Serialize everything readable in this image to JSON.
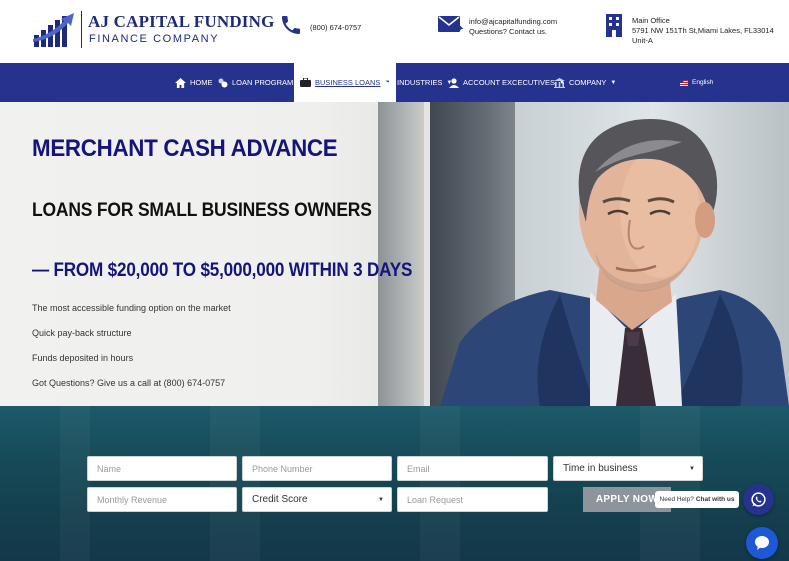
{
  "brand": {
    "title": "AJ CAPITAL FUNDING",
    "subtitle": "FINANCE COMPANY",
    "color": "#1e2a78"
  },
  "contacts": {
    "phone": "(800) 674-0757",
    "email_line1": "info@ajcapitalfunding.com",
    "email_line2": "Questions? Contact us.",
    "office_line1": "Main Office",
    "office_line2": "5791 NW 151Th St,Miami Lakes, FL33014",
    "office_line3": "Unit-A"
  },
  "nav": {
    "items": [
      {
        "label": "HOME",
        "icon": "home-icon"
      },
      {
        "label": "LOAN PROGRAMS",
        "icon": "coins-icon"
      },
      {
        "label": "BUSINESS LOANS",
        "icon": "briefcase-icon"
      },
      {
        "label": "INDUSTRIES",
        "icon": "factory-icon"
      },
      {
        "label": "ACCOUNT EXCECUTIVES",
        "icon": "user-icon"
      },
      {
        "label": "COMPANY",
        "icon": "building-icon"
      }
    ],
    "active": "BUSINESS LOANS",
    "language": "English",
    "color": "#26338e"
  },
  "hero": {
    "heading": "MERCHANT CASH ADVANCE",
    "subheading": "LOANS FOR SMALL BUSINESS OWNERS",
    "range": "— FROM $20,000 TO $5,000,000 WITHIN 3 DAYS",
    "bullets": [
      "The most accessible funding option on the market",
      "Quick pay-back structure",
      "Funds deposited in hours",
      "Got Questions? Give us a call at (800) 674-0757"
    ]
  },
  "form": {
    "name_placeholder": "Name",
    "phone_placeholder": "Phone Number",
    "email_placeholder": "Email",
    "time_in_business": "Time in business",
    "revenue_placeholder": "Monthly Revenue",
    "credit_score": "Credit Score",
    "loan_request_placeholder": "Loan Request",
    "apply_label": "APPLY NOW"
  },
  "widgets": {
    "help_text": "Need Help?",
    "help_bold": "Chat with us"
  }
}
